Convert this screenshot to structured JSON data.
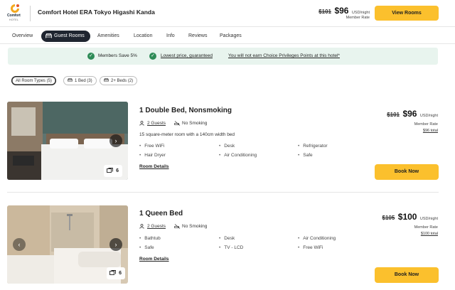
{
  "header": {
    "logo_text": "Comfort",
    "logo_sub": "HOTEL",
    "hotel_name": "Comfort Hotel ERA Tokyo Higashi Kanda",
    "old_price": "$101",
    "price": "$96",
    "unit": "USD/night",
    "member_label": "Member Rate",
    "cta": "View Rooms"
  },
  "tabs": [
    {
      "label": "Overview",
      "active": false
    },
    {
      "label": "Guest Rooms",
      "active": true
    },
    {
      "label": "Amenities",
      "active": false
    },
    {
      "label": "Location",
      "active": false
    },
    {
      "label": "Info",
      "active": false
    },
    {
      "label": "Reviews",
      "active": false
    },
    {
      "label": "Packages",
      "active": false
    }
  ],
  "banner": {
    "item1": "Members Save 5%",
    "item2": "Lowest price, guaranteed",
    "item3": "You will not earn Choice Privileges Points at this hotel*"
  },
  "filters": [
    {
      "label": "All Room Types (5)",
      "active": true
    },
    {
      "label": "1 Bed (3)",
      "active": false
    },
    {
      "label": "2+ Beds (2)",
      "active": false
    }
  ],
  "rooms": [
    {
      "title": "1 Double Bed, Nonsmoking",
      "guests": "2 Guests",
      "smoking": "No Smoking",
      "description": "15 square-meter room with a 140cm width bed",
      "amenities": [
        "Free WiFi",
        "Desk",
        "Refrigerator",
        "Hair Dryer",
        "Air Conditioning",
        "Safe"
      ],
      "details_label": "Room Details",
      "photo_count": "6",
      "old_price": "$101",
      "price": "$96",
      "unit": "USD/night",
      "member_label": "Member Rate",
      "total": "$96 total",
      "book_label": "Book Now"
    },
    {
      "title": "1 Queen Bed",
      "guests": "2 Guests",
      "smoking": "No Smoking",
      "amenities": [
        "Bathtub",
        "Desk",
        "Air Conditioning",
        "Safe",
        "TV - LCD",
        "Free WiFi"
      ],
      "details_label": "Room Details",
      "photo_count": "6",
      "old_price": "$105",
      "price": "$100",
      "unit": "USD/night",
      "member_label": "Member Rate",
      "total": "$100 total",
      "book_label": "Book Now"
    }
  ],
  "colors": {
    "accent_yellow": "#fbc02d",
    "active_tab": "#1f2530",
    "banner_bg": "#e8f4ee",
    "check_green": "#2e8b57"
  }
}
